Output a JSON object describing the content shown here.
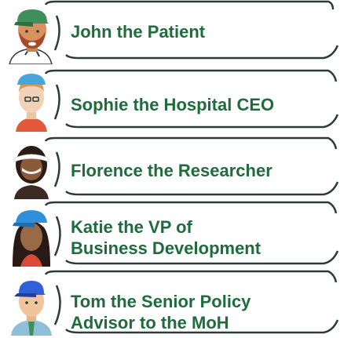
{
  "colors": {
    "text": "#1f6b3c",
    "frame": "#2d3b35"
  },
  "people": [
    {
      "name": "John the Patient",
      "icon": "patient-avatar-icon"
    },
    {
      "name": "Sophie the Hospital CEO",
      "icon": "hospital-ceo-avatar-icon"
    },
    {
      "name": "Florence the Researcher",
      "icon": "researcher-avatar-icon"
    },
    {
      "name": "Katie the VP of\nBusiness Development",
      "icon": "vp-business-development-avatar-icon"
    },
    {
      "name": "Tom the Senior Policy\nAdvisor to the MoH",
      "icon": "senior-policy-advisor-avatar-icon"
    }
  ]
}
